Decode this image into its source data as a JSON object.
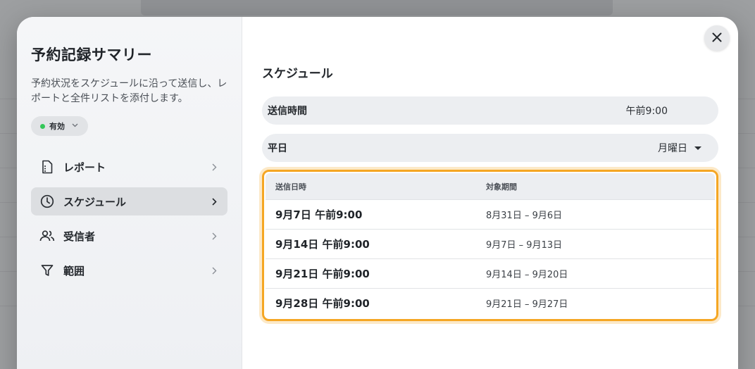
{
  "sidebar": {
    "title": "予約記録サマリー",
    "description": "予約状況をスケジュールに沿って送信し、レポートと全件リストを添付します。",
    "status": {
      "label": "有効",
      "color": "#34c759"
    },
    "items": [
      {
        "label": "レポート",
        "icon": "document-icon",
        "active": false
      },
      {
        "label": "スケジュール",
        "icon": "clock-icon",
        "active": true
      },
      {
        "label": "受信者",
        "icon": "people-icon",
        "active": false
      },
      {
        "label": "範囲",
        "icon": "filter-icon",
        "active": false
      }
    ]
  },
  "main": {
    "section_title": "スケジュール",
    "send_time": {
      "label": "送信時間",
      "value": "午前9:00"
    },
    "weekday": {
      "label": "平日",
      "value": "月曜日"
    },
    "table": {
      "headers": [
        "送信日時",
        "対象期間"
      ],
      "rows": [
        {
          "datetime": "9月7日 午前9:00",
          "period": "8月31日 – 9月6日"
        },
        {
          "datetime": "9月14日 午前9:00",
          "period": "9月7日 – 9月13日"
        },
        {
          "datetime": "9月21日 午前9:00",
          "period": "9月14日 – 9月20日"
        },
        {
          "datetime": "9月28日 午前9:00",
          "period": "9月21日 – 9月27日"
        }
      ]
    }
  },
  "colors": {
    "highlight": "#f5a623",
    "active_bg": "#dcdee1",
    "status_dot": "#34c759"
  }
}
